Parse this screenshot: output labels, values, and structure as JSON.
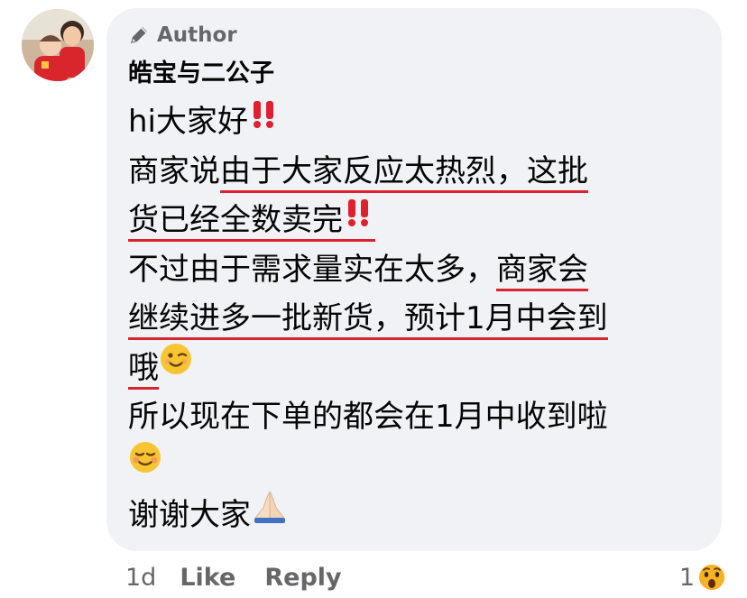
{
  "author_badge": {
    "label": "Author",
    "icon": "pencil-icon"
  },
  "comment": {
    "author_name": "皓宝与二公子",
    "line1": "hi大家好",
    "line2_a": "商家说",
    "line2_b": "由于大家反应太热烈，这批",
    "line3": "货已经全数卖完",
    "line4_a": "不过由于需求量实在太多，",
    "line4_b": "商家会",
    "line5": "继续进多一批新货，预计1月中会到",
    "line6": "哦",
    "line7": "所以现在下单的都会在1月中收到啦",
    "line9": "谢谢大家",
    "emojis": [
      "double-exclamation-icon",
      "winking-face-icon",
      "smiling-face-icon",
      "folded-hands-icon"
    ]
  },
  "actions": {
    "time": "1d",
    "like": "Like",
    "reply": "Reply"
  },
  "reactions": {
    "count": "1",
    "icon": "wow-reaction-icon"
  },
  "colors": {
    "bubble": "#f0f2f5",
    "underline": "#d9232e",
    "meta_text": "#65676b",
    "exclaim": "#e0202e",
    "wow": "#f7b125"
  }
}
